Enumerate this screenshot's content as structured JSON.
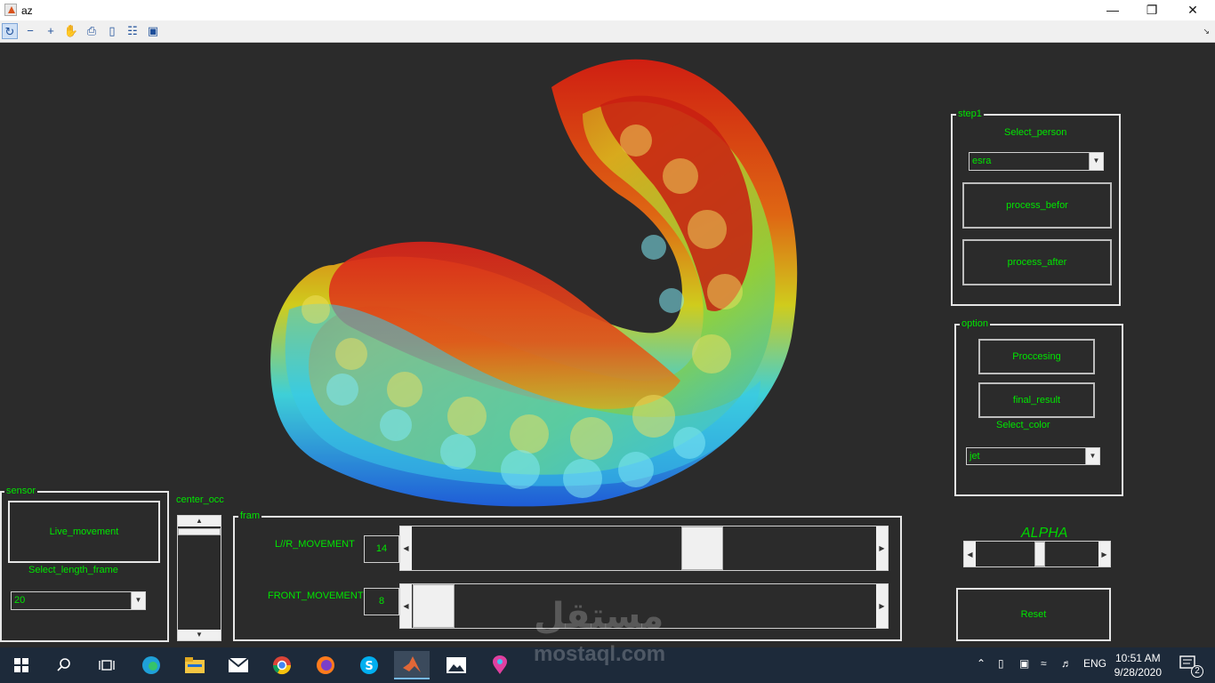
{
  "window": {
    "title": "az",
    "minimize": "—",
    "restore": "❐",
    "close": "✕"
  },
  "toolbar": {
    "tools": [
      "↻",
      "−",
      "+",
      "✋",
      "⎙",
      "▯",
      "☷",
      "▣"
    ],
    "corner_arrow": "↘"
  },
  "sensor": {
    "title": "sensor",
    "live_button": "Live_movement",
    "length_label": "Select_length_frame",
    "length_value": "20"
  },
  "center_occ": {
    "label": "center_occ"
  },
  "fram": {
    "title": "fram",
    "lr_label": "L//R_MOVEMENT",
    "lr_value": "14",
    "front_label": "FRONT_MOVEMENT",
    "front_value": "8"
  },
  "step1": {
    "title": "step1",
    "select_label": "Select_person",
    "person_value": "esra",
    "process_before": "process_befor",
    "process_after": "process_after"
  },
  "option": {
    "title": "option",
    "processing_button": "Proccesing",
    "final_button": "final_result",
    "color_label": "Select_color",
    "color_value": "jet"
  },
  "alpha": {
    "label": "ALPHA"
  },
  "reset": {
    "label": "Reset"
  },
  "watermark": {
    "arabic": "مستقل",
    "latin": "mostaql.com"
  },
  "taskbar": {
    "lang": "ENG",
    "time": "10:51 AM",
    "date": "9/28/2020",
    "notifications": "2"
  }
}
